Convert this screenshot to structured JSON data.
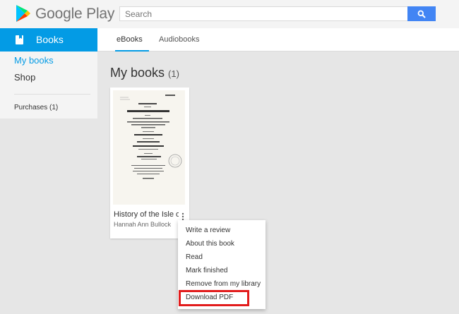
{
  "header": {
    "brand": "Google Play",
    "search_placeholder": "Search",
    "logo_icon": "google-play-logo",
    "search_icon": "search-icon"
  },
  "nav": {
    "active_label": "Books",
    "items": [
      {
        "label": "My books",
        "active": true
      },
      {
        "label": "Shop",
        "active": false
      }
    ],
    "purchases_label": "Purchases (1)"
  },
  "tabs": [
    {
      "label": "eBooks",
      "active": true
    },
    {
      "label": "Audiobooks",
      "active": false
    }
  ],
  "main": {
    "heading": "My books",
    "count": "(1)"
  },
  "book": {
    "title": "History of the Isle of Man",
    "author": "Hannah Ann Bullock"
  },
  "menu": {
    "items": [
      "Write a review",
      "About this book",
      "Read",
      "Mark finished",
      "Remove from my library",
      "Download PDF"
    ],
    "highlighted_item": "Download PDF",
    "highlight_color": "#e21b1b"
  },
  "colors": {
    "accent": "#039be5",
    "search_button": "#4285f4"
  }
}
